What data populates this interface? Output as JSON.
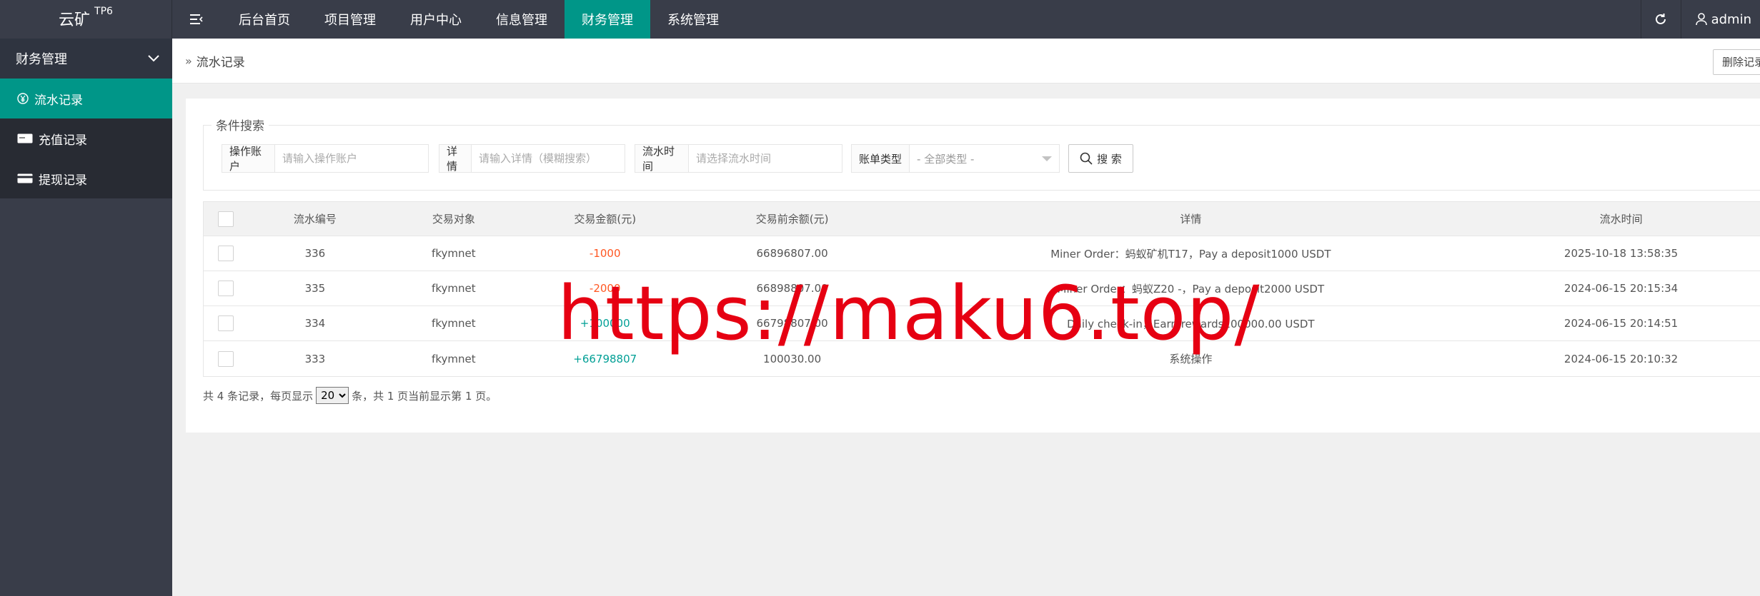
{
  "app": {
    "name": "云矿",
    "version": "TP6"
  },
  "nav": {
    "items": [
      {
        "label": "后台首页"
      },
      {
        "label": "项目管理"
      },
      {
        "label": "用户中心"
      },
      {
        "label": "信息管理"
      },
      {
        "label": "财务管理"
      },
      {
        "label": "系统管理"
      }
    ],
    "active": "财务管理"
  },
  "header_right": {
    "user": "admin"
  },
  "sidebar": {
    "group_label": "财务管理",
    "items": [
      {
        "label": "流水记录",
        "icon": "yen-circle-icon",
        "active": true
      },
      {
        "label": "充值记录",
        "icon": "card-icon"
      },
      {
        "label": "提现记录",
        "icon": "credit-card-icon"
      }
    ]
  },
  "breadcrumb": {
    "current": "流水记录"
  },
  "toolbar": {
    "delete_label": "删除记录"
  },
  "search": {
    "legend": "条件搜索",
    "account": {
      "label": "操作账户",
      "placeholder": "请输入操作账户"
    },
    "detail": {
      "label": "详情",
      "placeholder": "请输入详情（模糊搜索）"
    },
    "time": {
      "label": "流水时间",
      "placeholder": "请选择流水时间"
    },
    "type": {
      "label": "账单类型",
      "value": "- 全部类型 -"
    },
    "button": "搜 索"
  },
  "table": {
    "headers": [
      "流水编号",
      "交易对象",
      "交易金额(元)",
      "交易前余额(元)",
      "详情",
      "流水时间"
    ],
    "rows": [
      {
        "id": "336",
        "target": "fkymnet",
        "amount": "-1000",
        "before": "66896807.00",
        "detail": "Miner Order：蚂蚁矿机T17，Pay a deposit1000 USDT",
        "time": "2025-10-18 13:58:35"
      },
      {
        "id": "335",
        "target": "fkymnet",
        "amount": "-2000",
        "before": "66898807.00",
        "detail": "Miner Order：蚂蚁Z20 -，Pay a deposit2000 USDT",
        "time": "2024-06-15 20:15:34"
      },
      {
        "id": "334",
        "target": "fkymnet",
        "amount": "+100000",
        "before": "66798807.00",
        "detail": "Daily check-in，Earn rewards100000.00 USDT",
        "time": "2024-06-15 20:14:51"
      },
      {
        "id": "333",
        "target": "fkymnet",
        "amount": "+66798807",
        "before": "100030.00",
        "detail": "系统操作",
        "time": "2024-06-15 20:10:32"
      }
    ]
  },
  "pager": {
    "prefix": "共 4 条记录，每页显示",
    "per_page": "20",
    "suffix": "条，共 1 页当前显示第 1 页。"
  },
  "watermark": "https://maku6.top/",
  "colors": {
    "accent": "#009688",
    "header": "#393d49",
    "negative": "#ff5722",
    "positive": "#009f95"
  }
}
